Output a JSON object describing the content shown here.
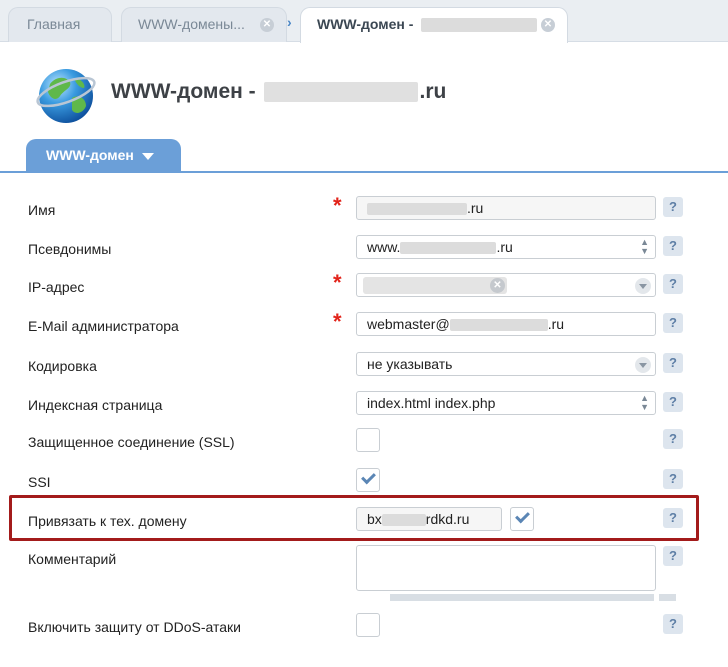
{
  "tabs": {
    "home": "Главная",
    "second": "WWW-домены...",
    "active": "WWW-домен -"
  },
  "page_title_prefix": "WWW-домен -",
  "page_title_suffix": ".ru",
  "section_tab": "WWW-домен",
  "help_glyph": "?",
  "required_mark": "*",
  "fields": {
    "name": {
      "label": "Имя",
      "suffix": ".ru"
    },
    "aliases": {
      "label": "Псевдонимы",
      "prefix": "www.",
      "suffix": ".ru"
    },
    "ip": {
      "label": "IP-адрес"
    },
    "email": {
      "label": "E-Mail администратора",
      "prefix": "webmaster@",
      "suffix": ".ru"
    },
    "encoding": {
      "label": "Кодировка",
      "value": "не указывать"
    },
    "index": {
      "label": "Индексная страница",
      "value": "index.html index.php"
    },
    "ssl": {
      "label": "Защищенное соединение (SSL)",
      "checked": false
    },
    "ssi": {
      "label": "SSI",
      "checked": true
    },
    "tech_domain": {
      "label": "Привязать к тех. домену",
      "prefix": "bx",
      "suffix": "rdkd.ru",
      "checked": true
    },
    "comment": {
      "label": "Комментарий"
    },
    "ddos": {
      "label": "Включить защиту от DDoS-атаки",
      "checked": false
    }
  },
  "colors": {
    "accent": "#6b9fd8",
    "highlight": "#a31b1b",
    "required": "#e2231a"
  }
}
